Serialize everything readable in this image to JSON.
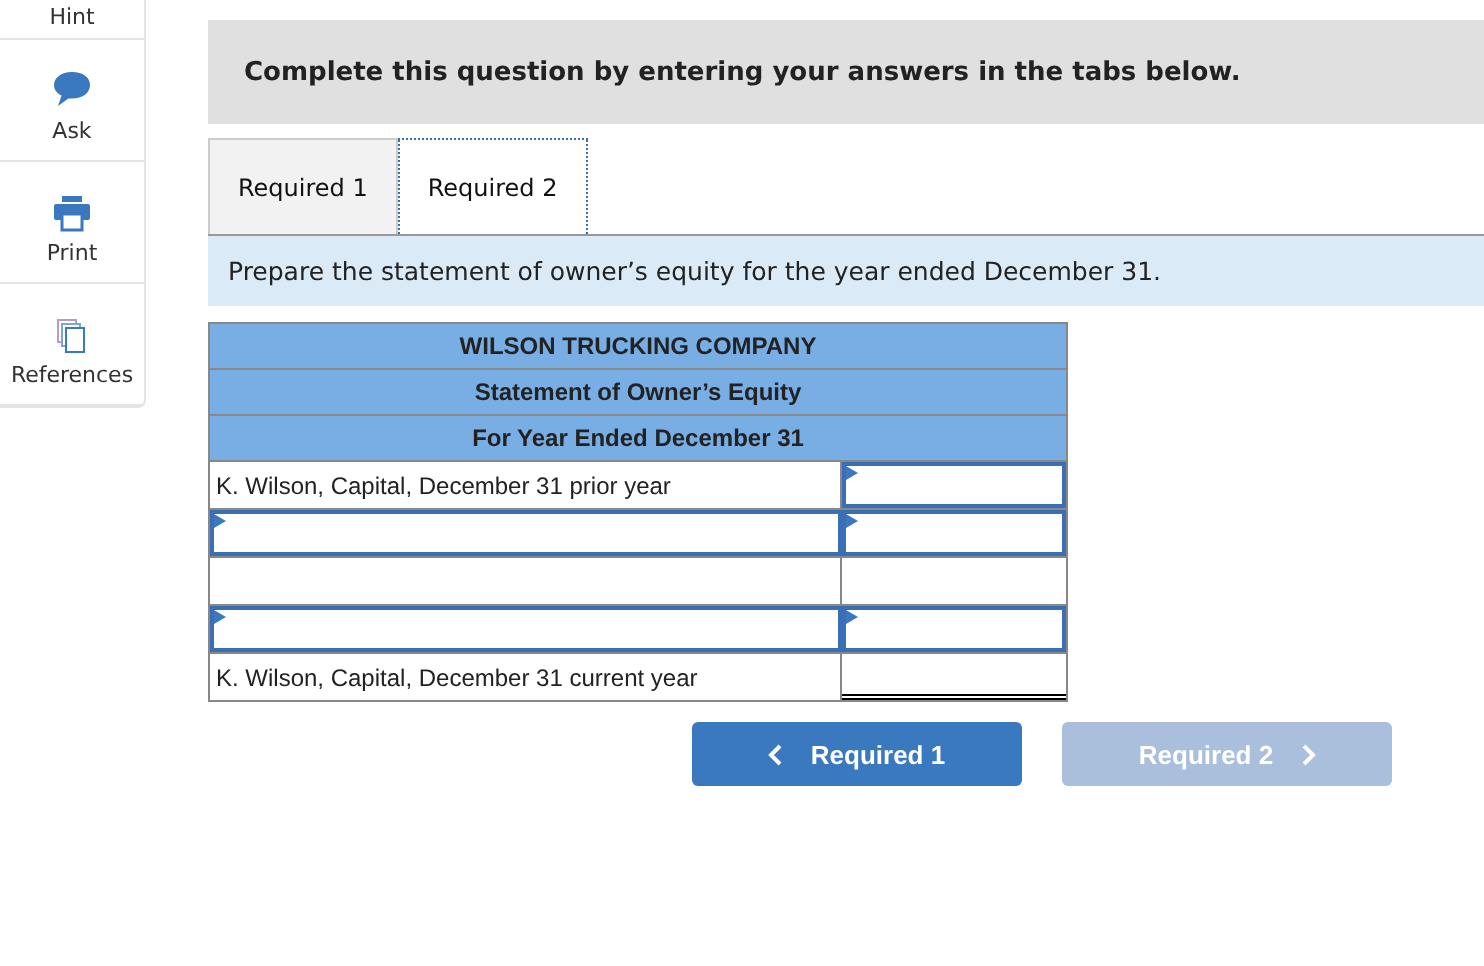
{
  "sidebar": {
    "items": [
      {
        "kind": "hint",
        "label": "Hint"
      },
      {
        "kind": "ask",
        "label": "Ask"
      },
      {
        "kind": "print",
        "label": "Print"
      },
      {
        "kind": "references",
        "label": "References"
      }
    ]
  },
  "banner": "Complete this question by entering your answers in the tabs below.",
  "tabs": [
    {
      "label": "Required 1",
      "selected": false
    },
    {
      "label": "Required 2",
      "selected": true
    }
  ],
  "instruction": "Prepare the statement of owner’s equity for the year ended December 31.",
  "statement": {
    "headings": [
      "WILSON TRUCKING COMPANY",
      "Statement of Owner’s Equity",
      "For Year Ended December 31"
    ],
    "rows": [
      {
        "kind": "given",
        "label": "K. Wilson, Capital, December 31 prior year"
      },
      {
        "kind": "entry"
      },
      {
        "kind": "blank"
      },
      {
        "kind": "entry"
      },
      {
        "kind": "total",
        "label": "K. Wilson, Capital, December 31 current year"
      }
    ]
  },
  "nav": [
    {
      "label": "Required 1",
      "kind": "prev",
      "disabled": false
    },
    {
      "label": "Required 2",
      "kind": "next",
      "disabled": true
    }
  ]
}
